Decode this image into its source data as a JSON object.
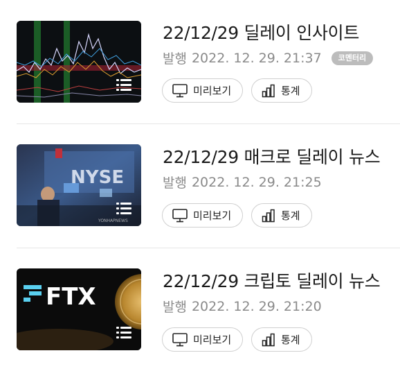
{
  "items": [
    {
      "title": "22/12/29 딜레이 인사이트",
      "published_label": "발행",
      "published_at": "2022. 12. 29. 21:37",
      "badge": "코멘터리",
      "preview_label": "미리보기",
      "stats_label": "통계",
      "thumbnail": "stock-chart-thumbnail"
    },
    {
      "title": "22/12/29 매크로 딜레이 뉴스",
      "published_label": "발행",
      "published_at": "2022. 12. 29. 21:25",
      "preview_label": "미리보기",
      "stats_label": "통계",
      "thumbnail": "nyse-trading-floor-thumbnail"
    },
    {
      "title": "22/12/29 크립토 딜레이 뉴스",
      "published_label": "발행",
      "published_at": "2022. 12. 29. 21:20",
      "preview_label": "미리보기",
      "stats_label": "통계",
      "thumbnail": "ftx-coin-thumbnail"
    }
  ]
}
